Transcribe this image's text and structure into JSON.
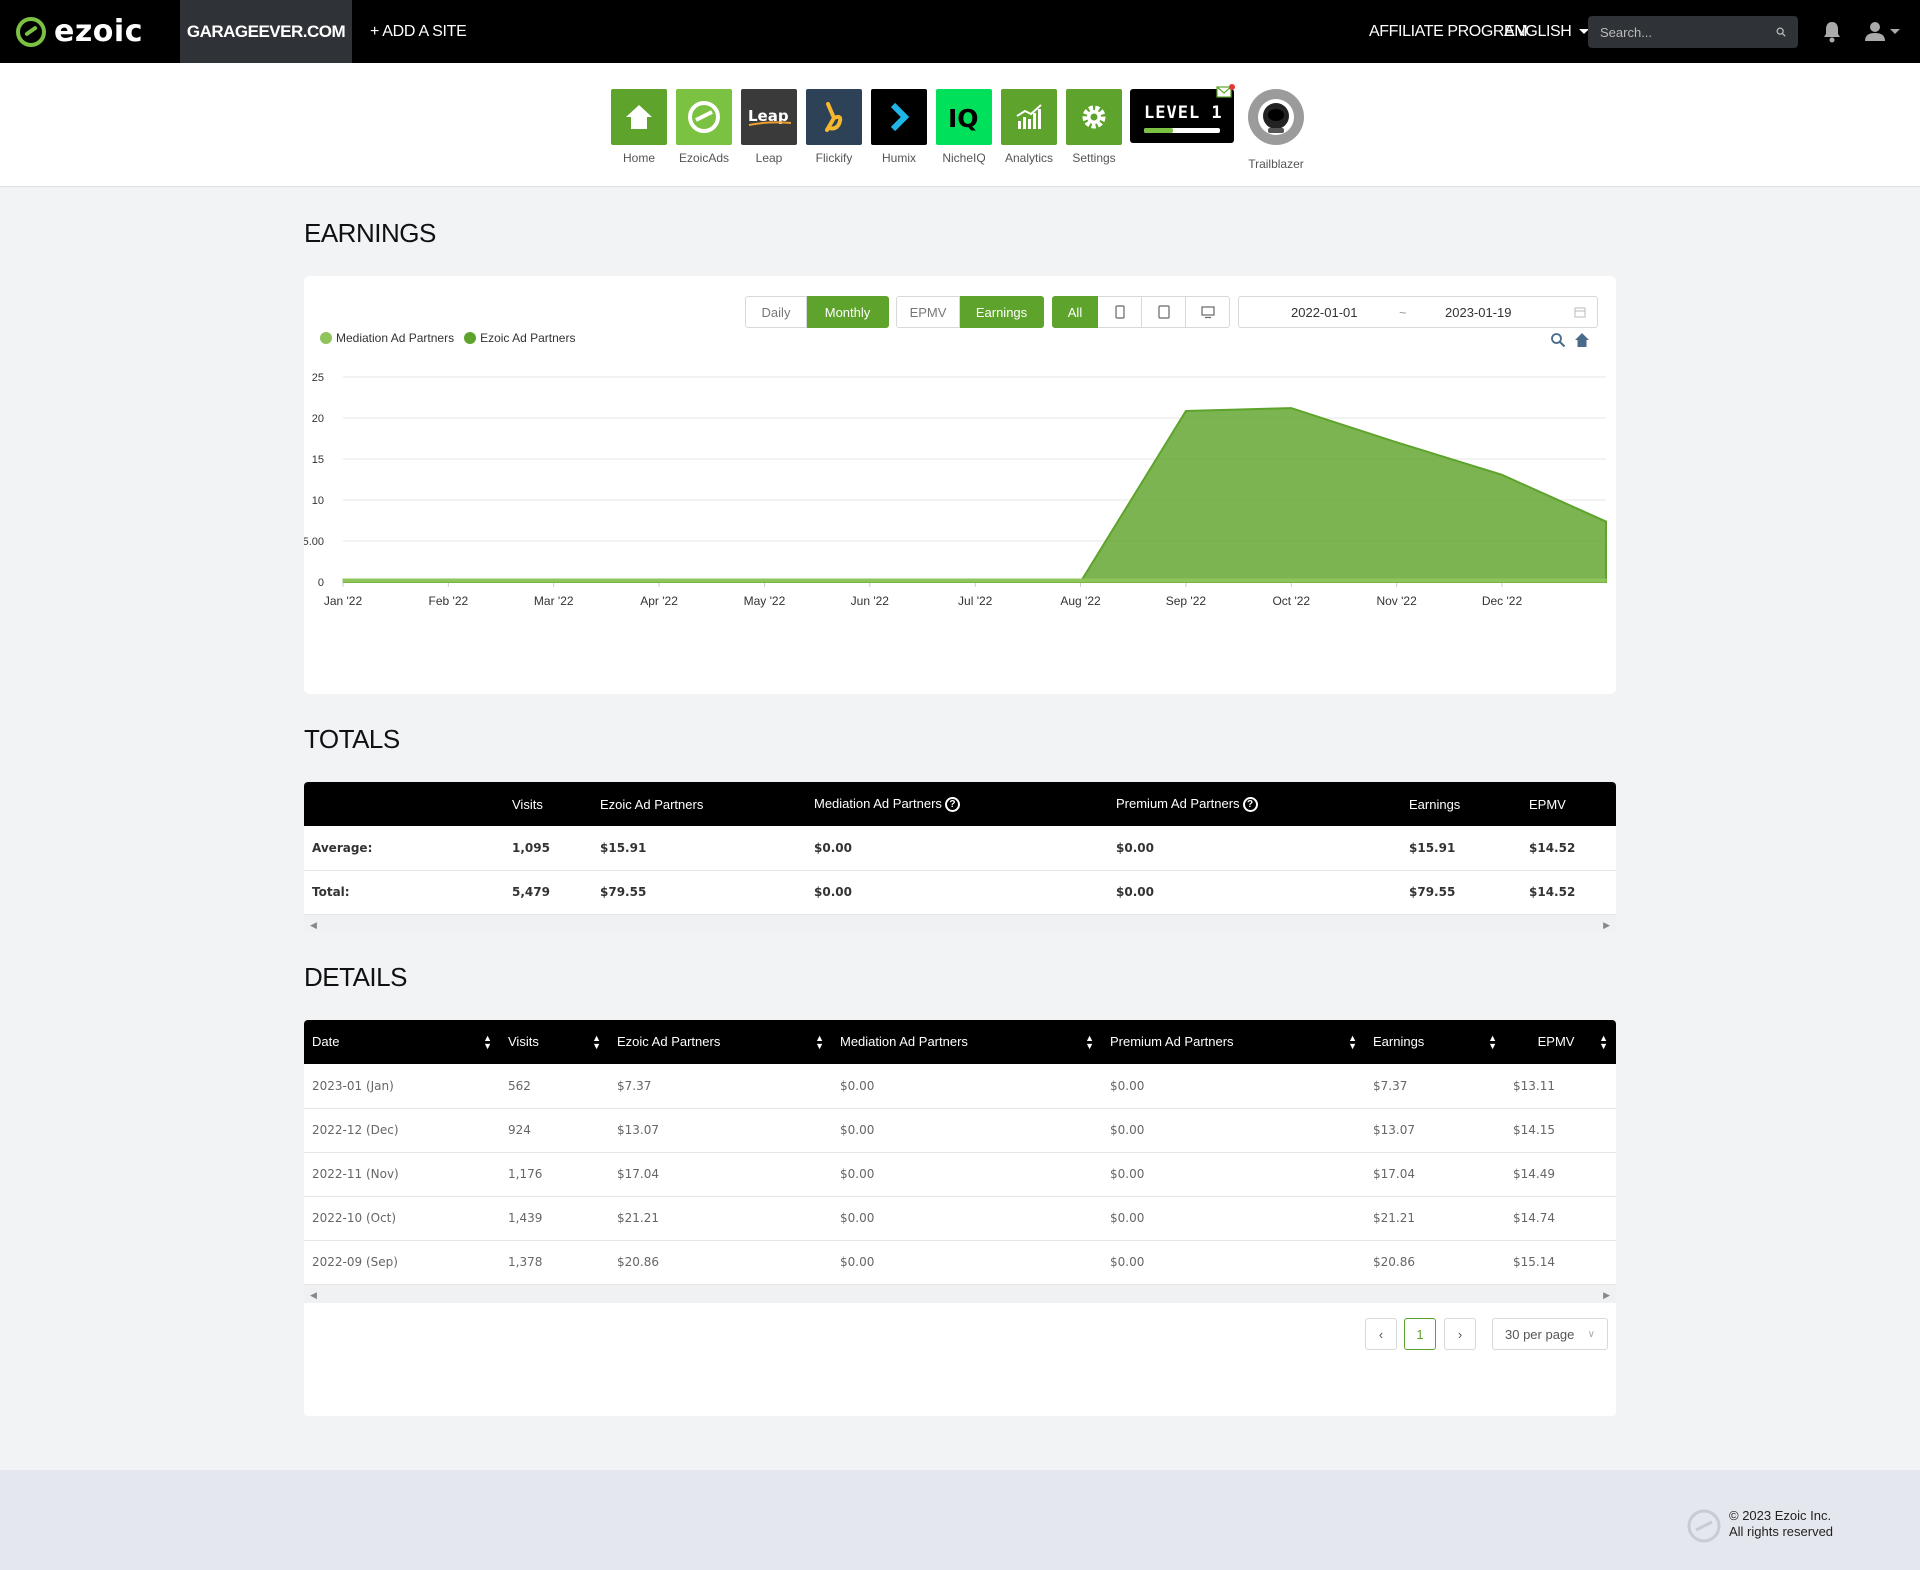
{
  "nav": {
    "brand": "ezoic",
    "site": "GARAGEEVER.COM",
    "add_site": "+ ADD A SITE",
    "affiliate": "AFFILIATE PROGRAM",
    "language": "ENGLISH",
    "search_placeholder": "Search..."
  },
  "apps": [
    {
      "label": "Home",
      "color": "#5ea32b"
    },
    {
      "label": "EzoicAds",
      "color": "#7bc142"
    },
    {
      "label": "Leap",
      "color": "#3a3a3a"
    },
    {
      "label": "Flickify",
      "color": "#2d4257"
    },
    {
      "label": "Humix",
      "color": "#000000"
    },
    {
      "label": "NicheIQ",
      "color": "#00e05a"
    },
    {
      "label": "Analytics",
      "color": "#5ea32b"
    },
    {
      "label": "Settings",
      "color": "#5ea32b"
    }
  ],
  "level": {
    "text": "LEVEL 1",
    "progress": 0.38
  },
  "trailblazer": "Trailblazer",
  "earnings": {
    "title": "EARNINGS",
    "period_buttons": [
      "Daily",
      "Monthly"
    ],
    "metric_buttons": [
      "EPMV",
      "Earnings"
    ],
    "device_all": "All",
    "date_start": "2022-01-01",
    "date_sep": "~",
    "date_end": "2023-01-19"
  },
  "chart_data": {
    "type": "area",
    "legend": [
      "Mediation Ad Partners",
      "Ezoic Ad Partners"
    ],
    "colors": [
      "#8ec45a",
      "#5ea32b"
    ],
    "x_ticks": [
      "Jan '22",
      "Feb '22",
      "Mar '22",
      "Apr '22",
      "May '22",
      "Jun '22",
      "Jul '22",
      "Aug '22",
      "Sep '22",
      "Oct '22",
      "Nov '22",
      "Dec '22"
    ],
    "y_ticks": [
      "0",
      "5.00",
      "10",
      "15",
      "20",
      "25"
    ],
    "ylim": [
      0,
      25
    ],
    "series": [
      {
        "name": "Mediation Ad Partners",
        "values": [
          0,
          0,
          0,
          0,
          0,
          0,
          0,
          0,
          0,
          0,
          0,
          0,
          0
        ]
      },
      {
        "name": "Ezoic Ad Partners",
        "values": [
          0,
          0,
          0,
          0,
          0,
          0,
          0,
          0,
          20.86,
          21.21,
          17.04,
          13.07,
          7.37
        ]
      }
    ],
    "x": [
      "Jan '22",
      "Feb '22",
      "Mar '22",
      "Apr '22",
      "May '22",
      "Jun '22",
      "Jul '22",
      "Aug '22",
      "Sep '22",
      "Oct '22",
      "Nov '22",
      "Dec '22",
      "Jan '23"
    ]
  },
  "totals": {
    "title": "TOTALS",
    "headers": [
      "",
      "Visits",
      "Ezoic Ad Partners",
      "Mediation Ad Partners",
      "Premium Ad Partners",
      "Earnings",
      "EPMV"
    ],
    "rows": [
      [
        "Average:",
        "1,095",
        "$15.91",
        "$0.00",
        "$0.00",
        "$15.91",
        "$14.52"
      ],
      [
        "Total:",
        "5,479",
        "$79.55",
        "$0.00",
        "$0.00",
        "$79.55",
        "$14.52"
      ]
    ]
  },
  "details": {
    "title": "DETAILS",
    "headers": [
      "Date",
      "Visits",
      "Ezoic Ad Partners",
      "Mediation Ad Partners",
      "Premium Ad Partners",
      "Earnings",
      "EPMV"
    ],
    "rows": [
      [
        "2023-01 (Jan)",
        "562",
        "$7.37",
        "$0.00",
        "$0.00",
        "$7.37",
        "$13.11"
      ],
      [
        "2022-12 (Dec)",
        "924",
        "$13.07",
        "$0.00",
        "$0.00",
        "$13.07",
        "$14.15"
      ],
      [
        "2022-11 (Nov)",
        "1,176",
        "$17.04",
        "$0.00",
        "$0.00",
        "$17.04",
        "$14.49"
      ],
      [
        "2022-10 (Oct)",
        "1,439",
        "$21.21",
        "$0.00",
        "$0.00",
        "$21.21",
        "$14.74"
      ],
      [
        "2022-09 (Sep)",
        "1,378",
        "$20.86",
        "$0.00",
        "$0.00",
        "$20.86",
        "$15.14"
      ]
    ],
    "page": "1",
    "per_page": "30 per page"
  },
  "footer": {
    "copyright": "© 2023 Ezoic Inc.",
    "rights": "All rights reserved"
  }
}
